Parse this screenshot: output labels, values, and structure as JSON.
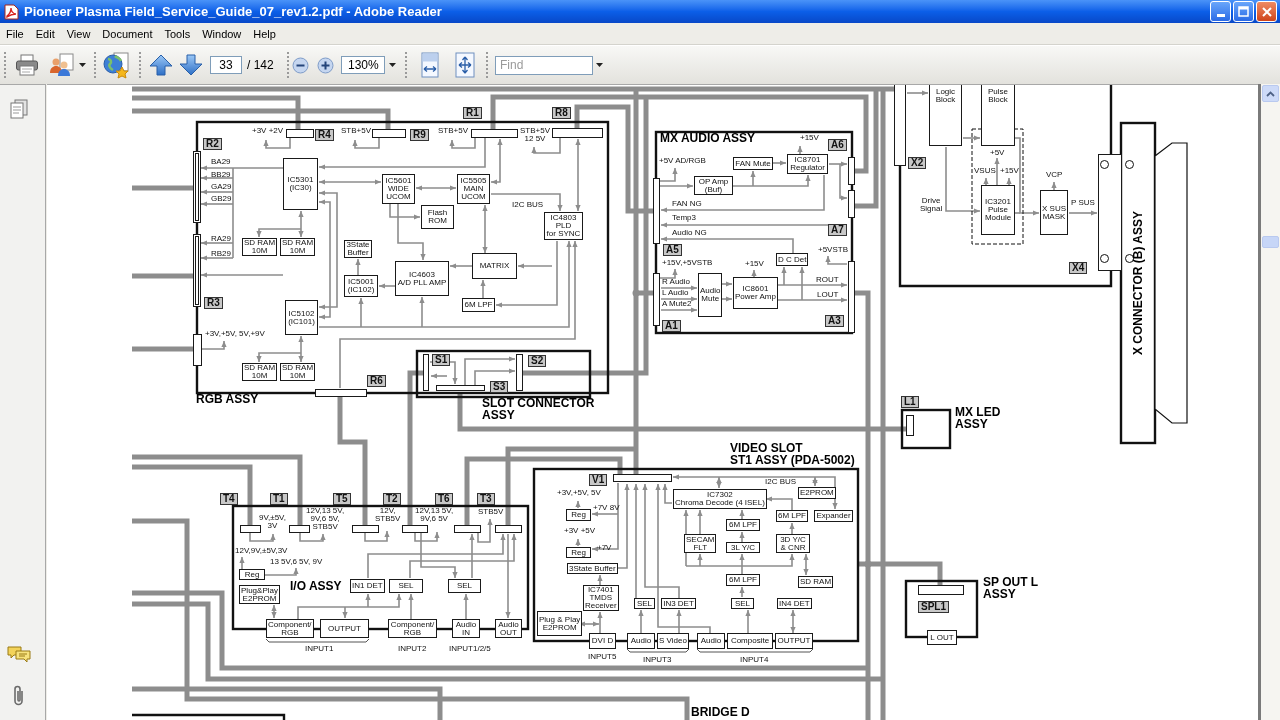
{
  "window": {
    "title": "Pioneer Plasma Field_Service_Guide_07_rev1.2.pdf - Adobe Reader"
  },
  "menu": [
    "File",
    "Edit",
    "View",
    "Document",
    "Tools",
    "Window",
    "Help"
  ],
  "toolbar": {
    "page": "33",
    "page_count": "/ 142",
    "zoom": "130%",
    "find_placeholder": "Find"
  },
  "diagram": {
    "assemblies": [
      {
        "title": "RGB ASSY",
        "tags": [
          "R1",
          "R8",
          "R4",
          "R9",
          "R2",
          "R3",
          "R6"
        ],
        "blocks": [
          "IC5301\n(IC30)",
          "IC5601\nWIDE\nUCOM",
          "IC5505\nMAIN\nUCOM",
          "Flash\nROM",
          "IC4803\nPLD\nfor SYNC",
          "SD RAM\n10M",
          "SD RAM\n10M",
          "3State\nBuffer",
          "MATRIX",
          "IC5001\n(IC102)",
          "IC4603\nA/D PLL AMP",
          "6M LPF",
          "IC5102\n(IC101)",
          "SD RAM\n10M",
          "SD RAM\n10M"
        ],
        "notes": [
          "+3V +2V",
          "STB+5V",
          "STB+5V",
          "STB+5V\n12 5V",
          "BA29",
          "BB29",
          "GA29",
          "GB29",
          "RA29",
          "RB29",
          "I2C BUS",
          "+3V,+5V, 5V,+9V"
        ]
      },
      {
        "title": "SLOT CONNECTOR\nASSY",
        "tags": [
          "S1",
          "S2",
          "S3"
        ]
      },
      {
        "title": "MX AUDIO ASSY",
        "tags": [
          "A6",
          "A7",
          "A5",
          "A1",
          "A3"
        ],
        "blocks": [
          "FAN Mute",
          "IC8701\nRegulator",
          "OP Amp\n(Buf)",
          "D C Det",
          "Audio\nMute",
          "IC8601\nPower Amp"
        ],
        "notes": [
          "+15V",
          "+5V AD/RGB",
          "FAN NG",
          "Temp3",
          "Audio NG",
          "+5VSTB",
          "+15V,+5VSTB",
          "+15V",
          "R Audio",
          "L Audio",
          "A Mute2",
          "ROUT",
          "LOUT"
        ]
      },
      {
        "tags": [
          "X2",
          "X4"
        ],
        "blocks": [
          "Logic\nBlock",
          "Pulse\nBlock",
          "IC3201\nPulse\nModule",
          "X SUS\nMASK"
        ],
        "notes": [
          "+5V",
          "VSUS",
          "+15V",
          "Drive\nSignal",
          "VCP",
          "P SUS"
        ]
      },
      {
        "title": "X CONNECTOR (B) ASSY"
      },
      {
        "title": "MX LED\nASSY",
        "tags": [
          "L1"
        ]
      },
      {
        "title": "VIDEO SLOT\nST1 ASSY (PDA-5002)",
        "tags": [
          "V1"
        ],
        "blocks": [
          "E2PROM",
          "IC7302\nChroma Decode (4 ISEL)",
          "Expander",
          "Reg",
          "6M LPF",
          "6M LPF",
          "SECAM\nFLT",
          "3L Y/C",
          "3D Y/C\n& CNR",
          "Reg",
          "3State Buffer",
          "6M LPF",
          "SD RAM",
          "IC7401\nTMDS\nReceiver",
          "SEL",
          "IN3 DET",
          "SEL",
          "IN4 DET",
          "Plug & Play\nE2PROM",
          "DVI D",
          "Audio",
          "S Video",
          "Audio",
          "Composite",
          "OUTPUT"
        ],
        "notes": [
          "I2C BUS",
          "+3V,+5V, 5V",
          "+7V 8V",
          "+3V +5V",
          "+7V",
          "INPUT5",
          "INPUT3",
          "INPUT4"
        ]
      },
      {
        "title": "I/O ASSY",
        "tags": [
          "T4",
          "T1",
          "T5",
          "T2",
          "T6",
          "T3"
        ],
        "blocks": [
          "Reg",
          "Plug&Play\nE2PROM",
          "IN1 DET",
          "SEL",
          "SEL",
          "Component/\nRGB",
          "OUTPUT",
          "Component/\nRGB",
          "Audio\nIN",
          "Audio\nOUT"
        ],
        "notes": [
          "9V,±5V,\n3V",
          "12V,13 5V,\n9V,6 5V,\nSTB5V",
          "12V,\nSTB5V",
          "12V,13 5V,\n9V,6 5V",
          "STB5V",
          "12V,9V,±5V,3V",
          "13 5V,6 5V, 9V",
          "INPUT1",
          "INPUT2",
          "INPUT1/2/5"
        ]
      },
      {
        "title": "SP OUT L\nASSY",
        "tags": [
          "SPL1"
        ],
        "blocks": [
          "L OUT"
        ]
      },
      {
        "title": "BRIDGE D"
      }
    ]
  }
}
